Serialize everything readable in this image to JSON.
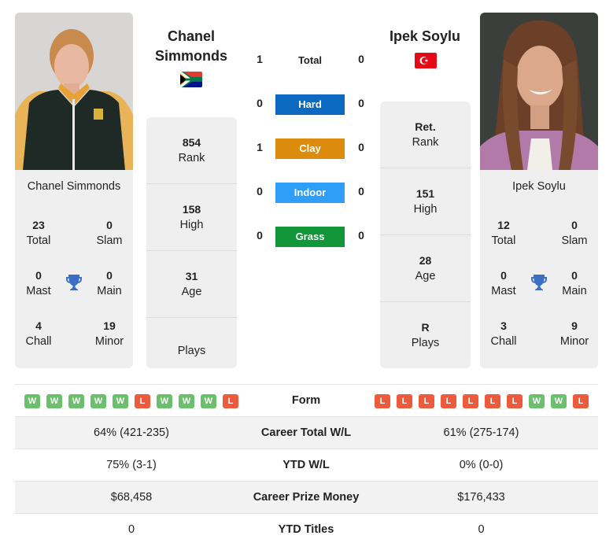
{
  "colors": {
    "hard": "#0b6ac0",
    "clay": "#dd8b0c",
    "indoor": "#2e9ef8",
    "grass": "#12963a",
    "win": "#6cbf6c",
    "loss": "#ee5a3c",
    "trophy": "#3a6fc4"
  },
  "player_left": {
    "name": "Chanel Simmonds",
    "name_line1": "Chanel",
    "name_line2": "Simmonds",
    "flag": "south-africa-flag",
    "photo": "player-photo",
    "info": [
      {
        "value": "854",
        "label": "Rank"
      },
      {
        "value": "158",
        "label": "High"
      },
      {
        "value": "31",
        "label": "Age"
      },
      {
        "value": "",
        "label": "Plays"
      }
    ],
    "titles": {
      "total": {
        "value": "23",
        "label": "Total"
      },
      "slam": {
        "value": "0",
        "label": "Slam"
      },
      "mast": {
        "value": "0",
        "label": "Mast"
      },
      "main": {
        "value": "0",
        "label": "Main"
      },
      "chall": {
        "value": "4",
        "label": "Chall"
      },
      "minor": {
        "value": "19",
        "label": "Minor"
      }
    },
    "form": [
      "W",
      "W",
      "W",
      "W",
      "W",
      "L",
      "W",
      "W",
      "W",
      "L"
    ]
  },
  "player_right": {
    "name": "Ipek Soylu",
    "flag": "turkey-flag",
    "photo": "player-photo",
    "info": [
      {
        "value": "Ret.",
        "label": "Rank"
      },
      {
        "value": "151",
        "label": "High"
      },
      {
        "value": "28",
        "label": "Age"
      },
      {
        "value": "R",
        "label": "Plays"
      }
    ],
    "titles": {
      "total": {
        "value": "12",
        "label": "Total"
      },
      "slam": {
        "value": "0",
        "label": "Slam"
      },
      "mast": {
        "value": "0",
        "label": "Mast"
      },
      "main": {
        "value": "0",
        "label": "Main"
      },
      "chall": {
        "value": "3",
        "label": "Chall"
      },
      "minor": {
        "value": "9",
        "label": "Minor"
      }
    },
    "form": [
      "L",
      "L",
      "L",
      "L",
      "L",
      "L",
      "L",
      "W",
      "W",
      "L"
    ]
  },
  "h2h": {
    "total": {
      "label": "Total",
      "left": "1",
      "right": "0"
    },
    "surfaces": [
      {
        "label": "Hard",
        "left": "0",
        "right": "0"
      },
      {
        "label": "Clay",
        "left": "1",
        "right": "0"
      },
      {
        "label": "Indoor",
        "left": "0",
        "right": "0"
      },
      {
        "label": "Grass",
        "left": "0",
        "right": "0"
      }
    ]
  },
  "stats": {
    "form_label": "Form",
    "rows": [
      {
        "label": "Career Total W/L",
        "left": "64% (421-235)",
        "right": "61% (275-174)"
      },
      {
        "label": "YTD W/L",
        "left": "75% (3-1)",
        "right": "0% (0-0)"
      },
      {
        "label": "Career Prize Money",
        "left": "$68,458",
        "right": "$176,433"
      },
      {
        "label": "YTD Titles",
        "left": "0",
        "right": "0"
      }
    ]
  }
}
